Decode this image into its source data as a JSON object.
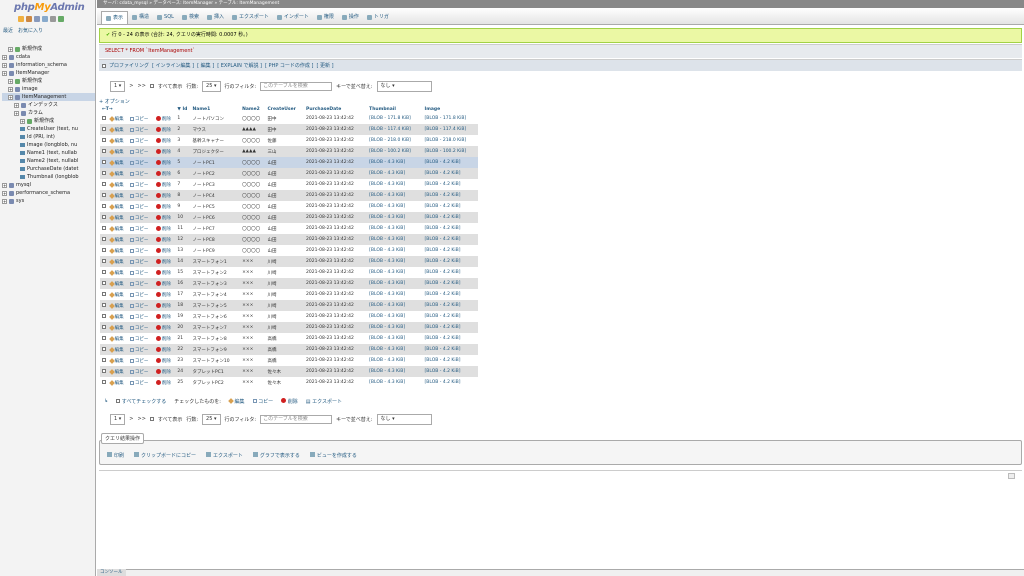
{
  "sidebar": {
    "logo": {
      "php": "php",
      "my": "My",
      "admin": "Admin"
    },
    "links": [
      "最近",
      "お気に入り"
    ],
    "tree": [
      {
        "label": "新規作成",
        "indent": 1,
        "type": "new"
      },
      {
        "label": "cdata",
        "indent": 0,
        "type": "db"
      },
      {
        "label": "information_schema",
        "indent": 0,
        "type": "db"
      },
      {
        "label": "ItemManager",
        "indent": 0,
        "type": "db"
      },
      {
        "label": "新規作成",
        "indent": 1,
        "type": "new"
      },
      {
        "label": "image",
        "indent": 1,
        "type": "db"
      },
      {
        "label": "ItemManagement",
        "indent": 1,
        "type": "db",
        "selected": true
      },
      {
        "label": "インデックス",
        "indent": 2,
        "type": "db"
      },
      {
        "label": "カラム",
        "indent": 2,
        "type": "db"
      },
      {
        "label": "新規作成",
        "indent": 3,
        "type": "new"
      },
      {
        "label": "CreateUser (text, nu",
        "indent": 3,
        "type": "col"
      },
      {
        "label": "Id (PRI, int)",
        "indent": 3,
        "type": "col"
      },
      {
        "label": "Image (longblob, nu",
        "indent": 3,
        "type": "col"
      },
      {
        "label": "Name1 (text, nullab",
        "indent": 3,
        "type": "col"
      },
      {
        "label": "Name2 (text, nullabl",
        "indent": 3,
        "type": "col"
      },
      {
        "label": "PurchaseDate (datet",
        "indent": 3,
        "type": "col"
      },
      {
        "label": "Thumbnail (longblob",
        "indent": 3,
        "type": "col"
      },
      {
        "label": "mysql",
        "indent": 0,
        "type": "db"
      },
      {
        "label": "performance_schema",
        "indent": 0,
        "type": "db"
      },
      {
        "label": "sys",
        "indent": 0,
        "type": "db"
      }
    ]
  },
  "topbar": "サーバ: cdata_mysql » データベース: ItemManager » テーブル: ItemManagement",
  "tabs": [
    "表示",
    "構造",
    "SQL",
    "検索",
    "挿入",
    "エクスポート",
    "インポート",
    "権限",
    "操作",
    "トリガ"
  ],
  "success": "行 0 - 24 の表示 (合計: 24, クエリの実行時間: 0.0007 秒。)",
  "sql": "SELECT * FROM `ItemManagement`",
  "profiling": [
    "プロファイリング",
    "[ インライン編集 ]",
    "[ 編集 ]",
    "[ EXPLAIN で解説 ]",
    "[ PHP コードの作成 ]",
    "[ 更新 ]"
  ],
  "nav": {
    "page": "1",
    "next": ">",
    "last": ">>",
    "show_all": "すべて表示",
    "rows_label": "行数:",
    "rows_value": "25",
    "filter_label": "行のフィルタ:",
    "filter_placeholder": "このテーブルを検索",
    "sort_label": "キーで並べ替え:",
    "sort_value": "なし"
  },
  "options_label": "+ オプション",
  "columns": [
    "Id",
    "Name1",
    "Name2",
    "CreateUser",
    "PurchaseDate",
    "Thumbnail",
    "Image"
  ],
  "row_actions": {
    "edit": "編集",
    "copy": "コピー",
    "delete": "削除"
  },
  "rows": [
    {
      "id": "1",
      "name1": "ノートパソコン",
      "name2": "〇〇〇〇",
      "user": "田中",
      "date": "2021-08-23 13:42:42",
      "thumb": "[BLOB - 171.8 KiB]",
      "image": "[BLOB - 171.8 KiB]"
    },
    {
      "id": "2",
      "name1": "マウス",
      "name2": "▲▲▲▲",
      "user": "田中",
      "date": "2021-08-23 13:42:42",
      "thumb": "[BLOB - 117.4 KiB]",
      "image": "[BLOB - 117.4 KiB]"
    },
    {
      "id": "3",
      "name1": "基幹スキャナー",
      "name2": "〇〇〇〇",
      "user": "佐藤",
      "date": "2021-08-23 13:42:42",
      "thumb": "[BLOB - 218.0 KiB]",
      "image": "[BLOB - 218.0 KiB]"
    },
    {
      "id": "4",
      "name1": "プロジェクター",
      "name2": "▲▲▲▲",
      "user": "三山",
      "date": "2021-08-23 13:42:42",
      "thumb": "[BLOB - 100.2 KiB]",
      "image": "[BLOB - 100.2 KiB]"
    },
    {
      "id": "5",
      "name1": "ノートPC1",
      "name2": "〇〇〇〇",
      "user": "山田",
      "date": "2021-08-23 13:42:42",
      "thumb": "[BLOB - 4.3 KiB]",
      "image": "[BLOB - 4.2 KiB]"
    },
    {
      "id": "6",
      "name1": "ノートPC2",
      "name2": "〇〇〇〇",
      "user": "山田",
      "date": "2021-08-23 13:42:42",
      "thumb": "[BLOB - 4.3 KiB]",
      "image": "[BLOB - 4.2 KiB]"
    },
    {
      "id": "7",
      "name1": "ノートPC3",
      "name2": "〇〇〇〇",
      "user": "山田",
      "date": "2021-08-23 13:42:42",
      "thumb": "[BLOB - 4.3 KiB]",
      "image": "[BLOB - 4.2 KiB]"
    },
    {
      "id": "8",
      "name1": "ノートPC4",
      "name2": "〇〇〇〇",
      "user": "山田",
      "date": "2021-08-23 13:42:42",
      "thumb": "[BLOB - 4.3 KiB]",
      "image": "[BLOB - 4.2 KiB]"
    },
    {
      "id": "9",
      "name1": "ノートPC5",
      "name2": "〇〇〇〇",
      "user": "山田",
      "date": "2021-08-23 13:42:42",
      "thumb": "[BLOB - 4.3 KiB]",
      "image": "[BLOB - 4.2 KiB]"
    },
    {
      "id": "10",
      "name1": "ノートPC6",
      "name2": "〇〇〇〇",
      "user": "山田",
      "date": "2021-08-23 13:42:42",
      "thumb": "[BLOB - 4.3 KiB]",
      "image": "[BLOB - 4.2 KiB]"
    },
    {
      "id": "11",
      "name1": "ノートPC7",
      "name2": "〇〇〇〇",
      "user": "山田",
      "date": "2021-08-23 13:42:42",
      "thumb": "[BLOB - 4.3 KiB]",
      "image": "[BLOB - 4.2 KiB]"
    },
    {
      "id": "12",
      "name1": "ノートPC8",
      "name2": "〇〇〇〇",
      "user": "山田",
      "date": "2021-08-23 13:42:42",
      "thumb": "[BLOB - 4.3 KiB]",
      "image": "[BLOB - 4.2 KiB]"
    },
    {
      "id": "13",
      "name1": "ノートPC9",
      "name2": "〇〇〇〇",
      "user": "山田",
      "date": "2021-08-23 13:42:42",
      "thumb": "[BLOB - 4.3 KiB]",
      "image": "[BLOB - 4.2 KiB]"
    },
    {
      "id": "14",
      "name1": "スマートフォン1",
      "name2": "×××",
      "user": "川崎",
      "date": "2021-08-23 13:42:42",
      "thumb": "[BLOB - 4.3 KiB]",
      "image": "[BLOB - 4.2 KiB]"
    },
    {
      "id": "15",
      "name1": "スマートフォン2",
      "name2": "×××",
      "user": "川崎",
      "date": "2021-08-23 13:42:42",
      "thumb": "[BLOB - 4.3 KiB]",
      "image": "[BLOB - 4.2 KiB]"
    },
    {
      "id": "16",
      "name1": "スマートフォン3",
      "name2": "×××",
      "user": "川崎",
      "date": "2021-08-23 13:42:42",
      "thumb": "[BLOB - 4.3 KiB]",
      "image": "[BLOB - 4.2 KiB]"
    },
    {
      "id": "17",
      "name1": "スマートフォン4",
      "name2": "×××",
      "user": "川崎",
      "date": "2021-08-23 13:42:42",
      "thumb": "[BLOB - 4.3 KiB]",
      "image": "[BLOB - 4.2 KiB]"
    },
    {
      "id": "18",
      "name1": "スマートフォン5",
      "name2": "×××",
      "user": "川崎",
      "date": "2021-08-23 13:42:42",
      "thumb": "[BLOB - 4.3 KiB]",
      "image": "[BLOB - 4.2 KiB]"
    },
    {
      "id": "19",
      "name1": "スマートフォン6",
      "name2": "×××",
      "user": "川崎",
      "date": "2021-08-23 13:42:42",
      "thumb": "[BLOB - 4.3 KiB]",
      "image": "[BLOB - 4.2 KiB]"
    },
    {
      "id": "20",
      "name1": "スマートフォン7",
      "name2": "×××",
      "user": "川崎",
      "date": "2021-08-23 13:42:42",
      "thumb": "[BLOB - 4.3 KiB]",
      "image": "[BLOB - 4.2 KiB]"
    },
    {
      "id": "21",
      "name1": "スマートフォン8",
      "name2": "×××",
      "user": "高橋",
      "date": "2021-08-23 13:42:42",
      "thumb": "[BLOB - 4.3 KiB]",
      "image": "[BLOB - 4.2 KiB]"
    },
    {
      "id": "22",
      "name1": "スマートフォン9",
      "name2": "×××",
      "user": "高橋",
      "date": "2021-08-23 13:42:42",
      "thumb": "[BLOB - 4.3 KiB]",
      "image": "[BLOB - 4.2 KiB]"
    },
    {
      "id": "23",
      "name1": "スマートフォン10",
      "name2": "×××",
      "user": "高橋",
      "date": "2021-08-23 13:42:42",
      "thumb": "[BLOB - 4.3 KiB]",
      "image": "[BLOB - 4.2 KiB]"
    },
    {
      "id": "24",
      "name1": "タブレットPC1",
      "name2": "×××",
      "user": "佐々木",
      "date": "2021-08-23 13:42:42",
      "thumb": "[BLOB - 4.3 KiB]",
      "image": "[BLOB - 4.2 KiB]"
    },
    {
      "id": "25",
      "name1": "タブレットPC2",
      "name2": "×××",
      "user": "佐々木",
      "date": "2021-08-23 13:42:42",
      "thumb": "[BLOB - 4.3 KiB]",
      "image": "[BLOB - 4.2 KiB]"
    }
  ],
  "marked_row_index": 4,
  "bulk": {
    "check_all": "すべてチェックする",
    "with_selected": "チェックしたものを:",
    "edit": "編集",
    "copy": "コピー",
    "delete": "削除",
    "export": "エクスポート"
  },
  "query_ops": {
    "legend": "クエリ結果操作",
    "buttons": [
      "印刷",
      "クリップボードにコピー",
      "エクスポート",
      "グラフで表示する",
      "ビューを作成する"
    ]
  },
  "console": "コンソール",
  "colors": {
    "accent": "#235a81",
    "success_bg": "#ebf8a4",
    "sql_text": "#aa0000",
    "logo_php": "#6c78af",
    "logo_my": "#f89c0e"
  }
}
